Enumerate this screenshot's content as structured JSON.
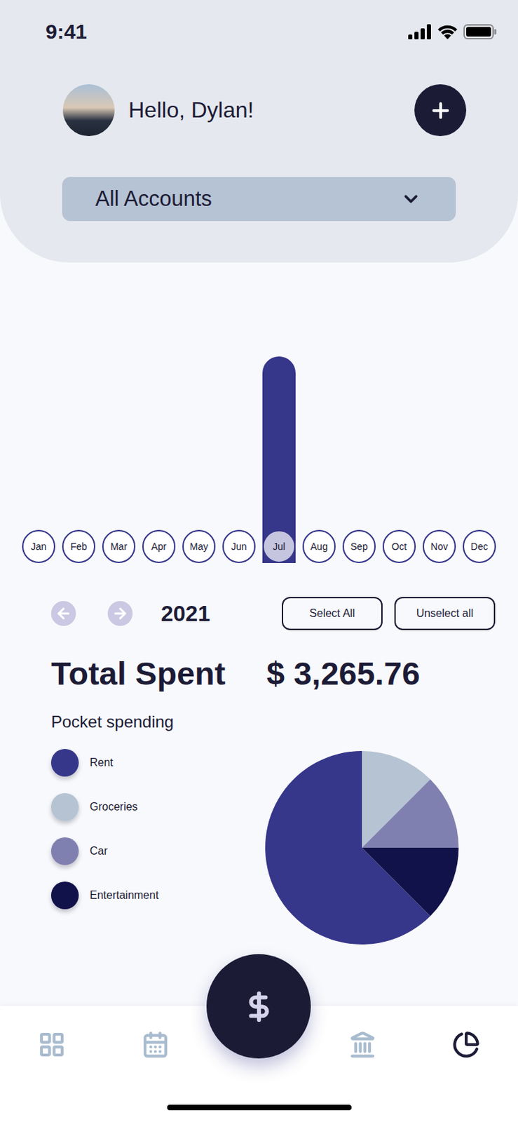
{
  "status_bar": {
    "time": "9:41"
  },
  "header": {
    "greeting": "Hello, Dylan!",
    "account_select": {
      "value": "All Accounts",
      "expanded": false
    }
  },
  "chart": {
    "months": [
      {
        "label": "Jan",
        "selected": false
      },
      {
        "label": "Feb",
        "selected": false
      },
      {
        "label": "Mar",
        "selected": false
      },
      {
        "label": "Apr",
        "selected": false
      },
      {
        "label": "May",
        "selected": false
      },
      {
        "label": "Jun",
        "selected": false
      },
      {
        "label": "Jul",
        "selected": true
      },
      {
        "label": "Aug",
        "selected": false
      },
      {
        "label": "Sep",
        "selected": false
      },
      {
        "label": "Oct",
        "selected": false
      },
      {
        "label": "Nov",
        "selected": false
      },
      {
        "label": "Dec",
        "selected": false
      }
    ],
    "series": [
      {
        "name": "Spent",
        "values": [
          0,
          0,
          0,
          0,
          0,
          0,
          3265.76,
          0,
          0,
          0,
          0,
          0
        ]
      }
    ]
  },
  "year_nav": {
    "year": "2021",
    "prev_disabled": true,
    "next_disabled": true
  },
  "buttons": [
    "Select All",
    "Unselect all"
  ],
  "total": {
    "label": "Total Spent",
    "amount": "$ 3,265.76"
  },
  "pocket_spending": {
    "title": "Pocket spending",
    "categories": [
      {
        "name": "Rent",
        "value": 2041.1,
        "color": "#36368a"
      },
      {
        "name": "Groceries",
        "value": 408.22,
        "color": "#b5c3d3"
      },
      {
        "name": "Car",
        "value": 408.22,
        "color": "#8080b0"
      },
      {
        "name": "Entertainment",
        "value": 408.22,
        "color": "#12124a"
      }
    ]
  },
  "nav": {
    "items": [
      {
        "selected": false
      },
      {
        "selected": false
      },
      {
        "selected": false
      },
      {
        "selected": true
      }
    ]
  }
}
